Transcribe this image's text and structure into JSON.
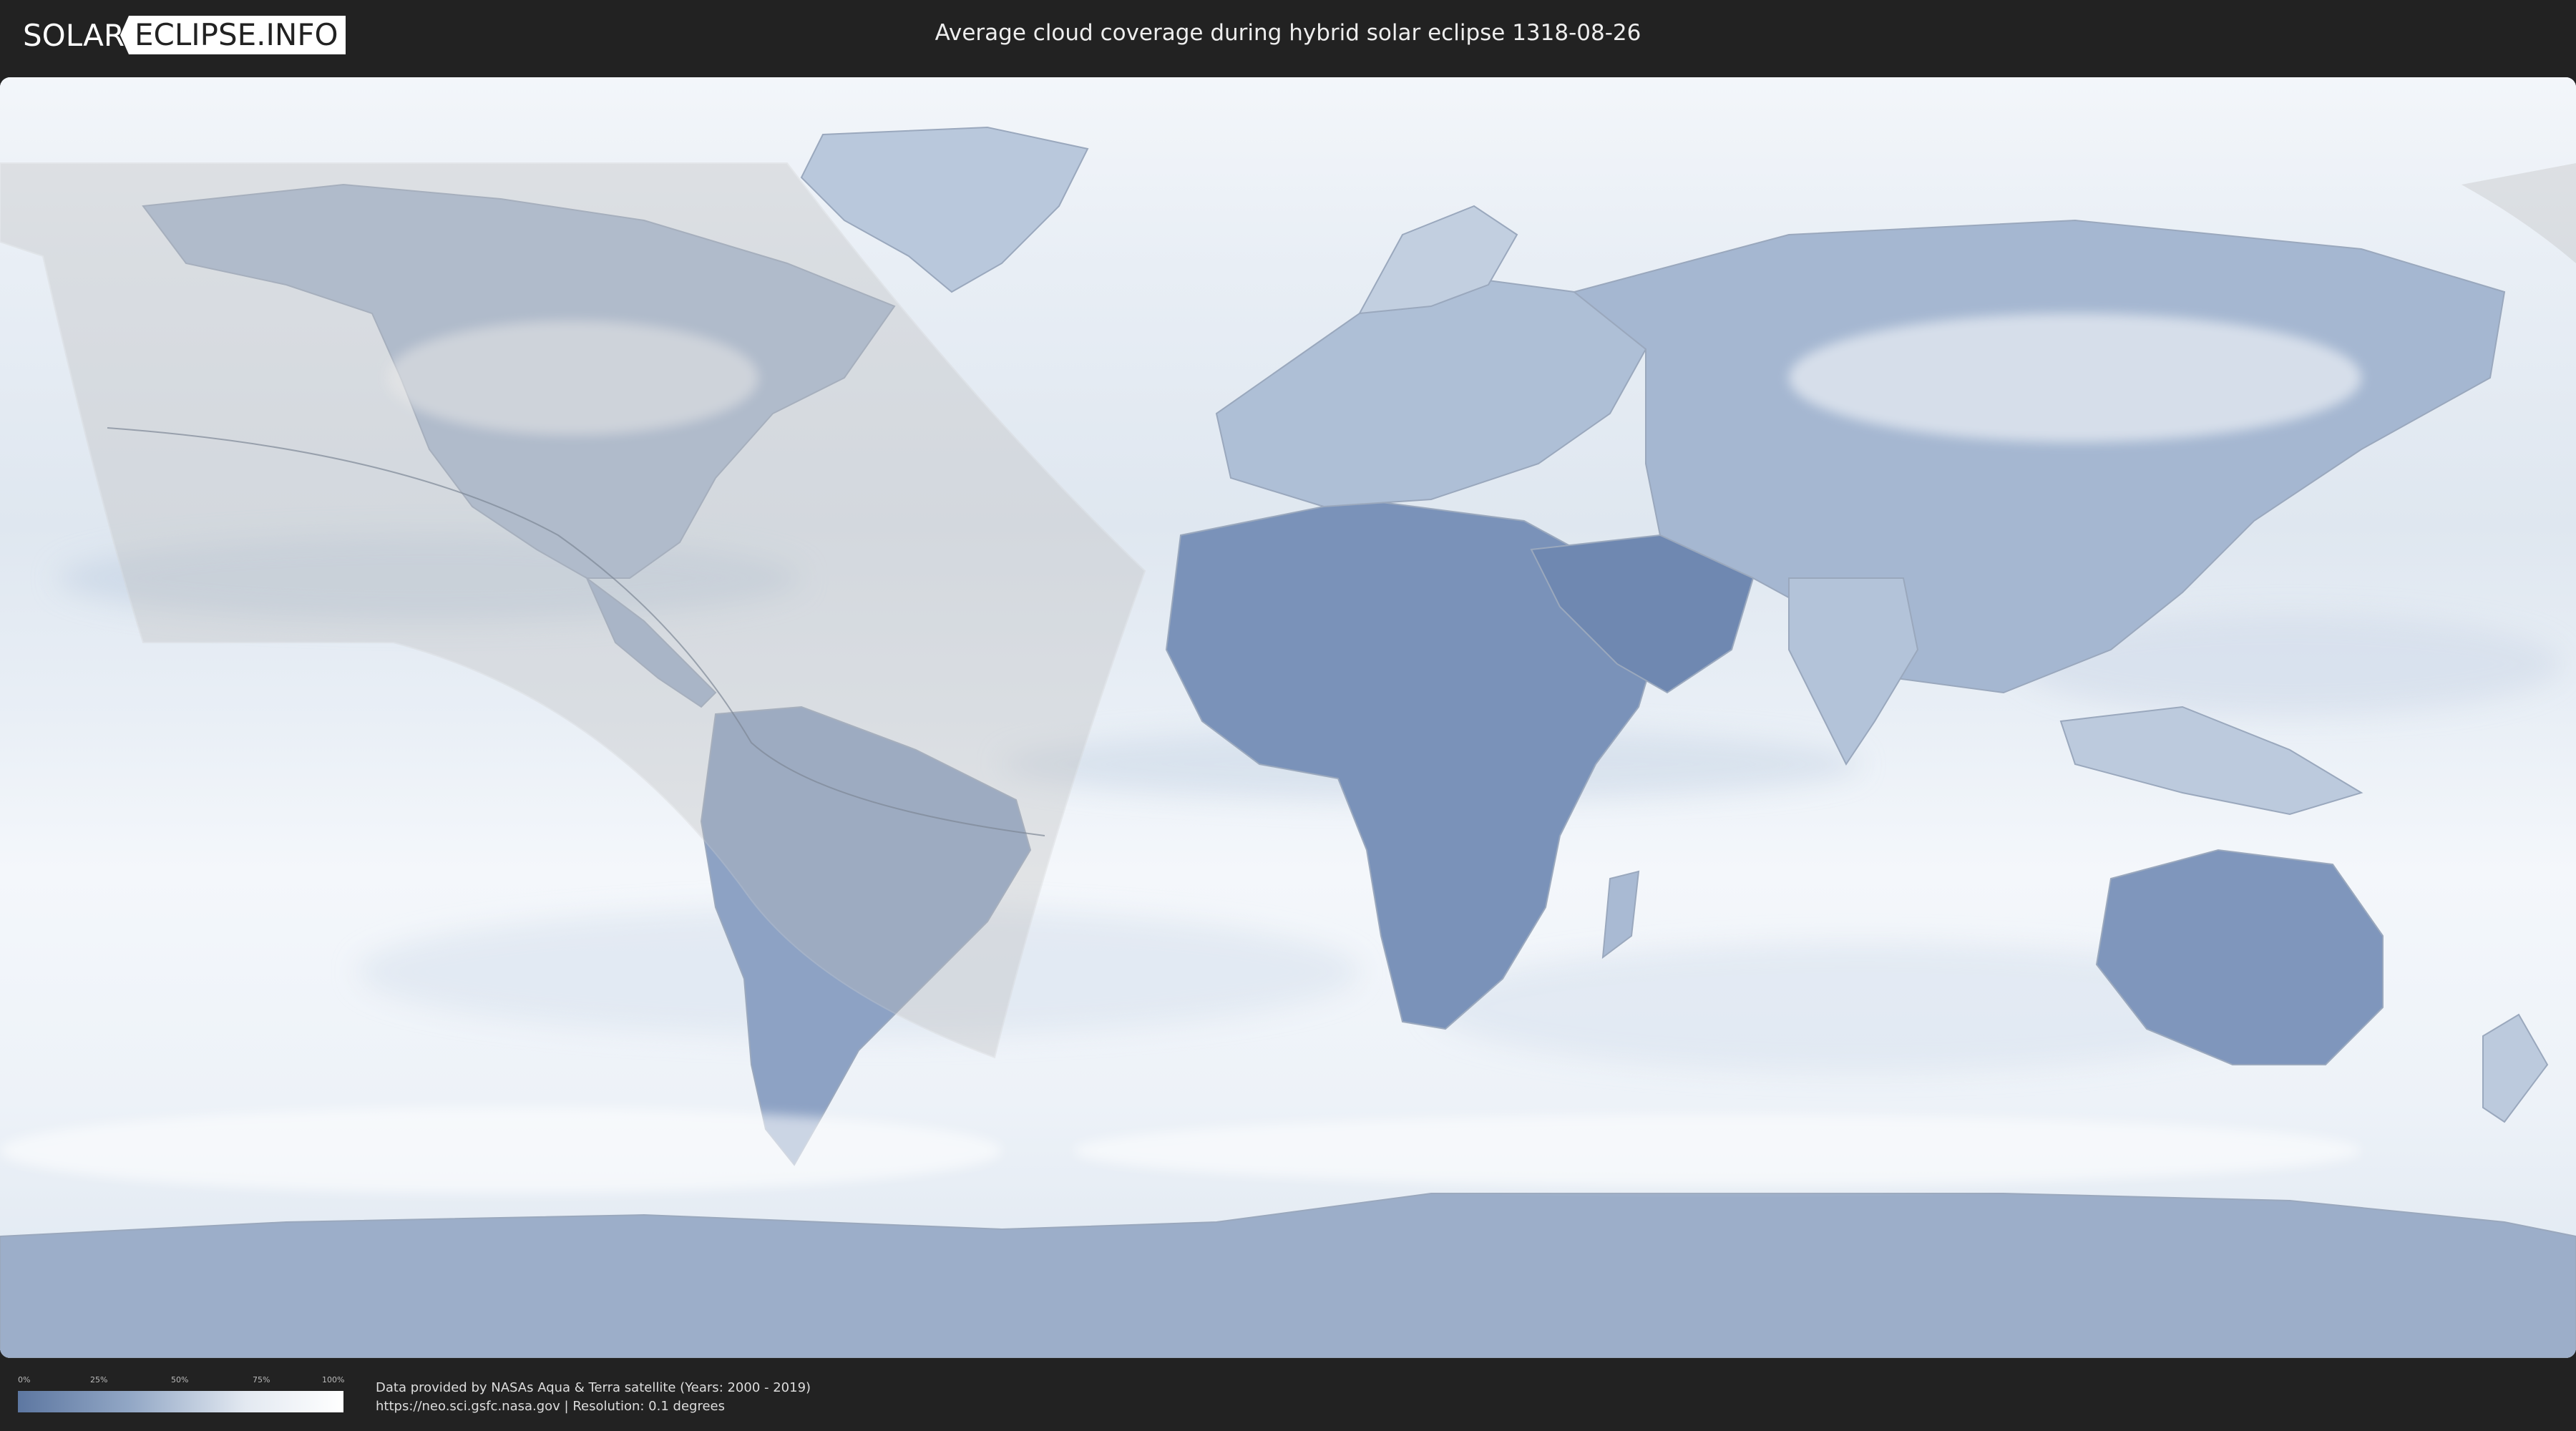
{
  "header": {
    "logo_part1": "SOLAR",
    "logo_part2": "ECLIPSE.INFO",
    "title": "Average cloud coverage during hybrid solar eclipse 1318-08-26"
  },
  "legend": {
    "ticks": [
      "0%",
      "25%",
      "50%",
      "75%",
      "100%"
    ],
    "gradient_colors": [
      "#5d77a1",
      "#93a8c6",
      "#e3e9f1",
      "#ffffff"
    ]
  },
  "credits": {
    "line1": "Data provided by NASAs Aqua & Terra satellite (Years: 2000 - 2019)",
    "line2": "https://neo.sci.gsfc.nasa.gov | Resolution: 0.1 degrees"
  },
  "colors": {
    "background": "#222222",
    "ocean_cloud": "#e9eff6",
    "clear_land": "#6c84ad",
    "eclipse_zone": "#c8c8c8"
  }
}
